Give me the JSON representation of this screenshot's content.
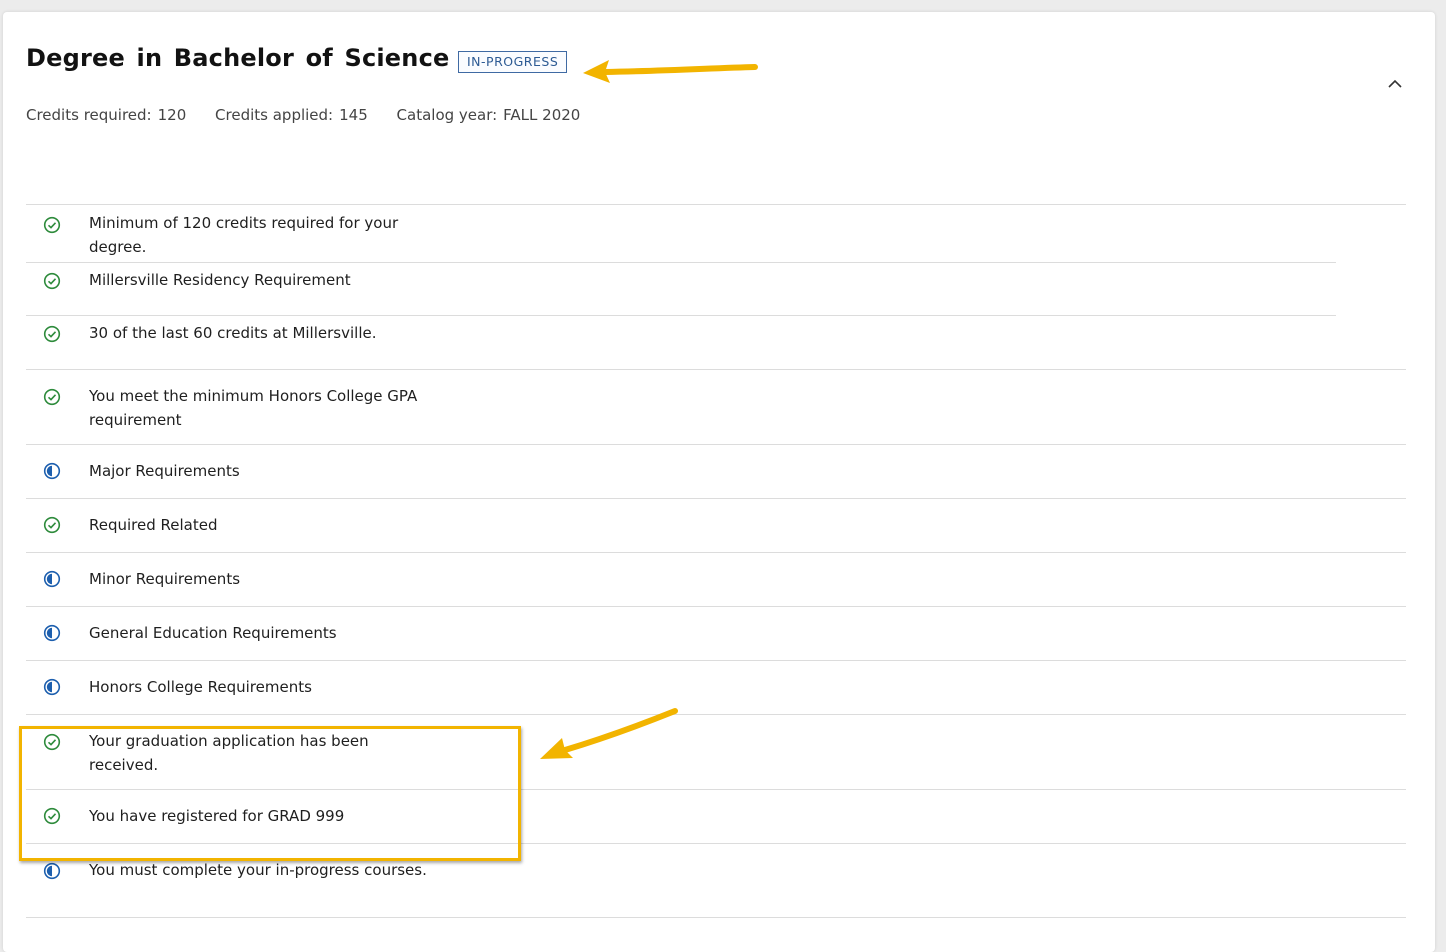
{
  "degree": {
    "title": "Degree in Bachelor of Science",
    "status": "IN-PROGRESS",
    "credits_required_label": "Credits required:",
    "credits_required": "120",
    "credits_applied_label": "Credits applied:",
    "credits_applied": "145",
    "catalog_year_label": "Catalog year:",
    "catalog_year": "FALL 2020"
  },
  "colors": {
    "complete": "#2e8b3c",
    "in_progress": "#1d5fae",
    "annotation": "#f2b400"
  },
  "requirements": [
    {
      "label": "Minimum of 120 credits required for your degree.",
      "status": "complete",
      "icon": "check-circle-icon"
    },
    {
      "label": "Millersville Residency Requirement",
      "status": "complete",
      "icon": "check-circle-icon"
    },
    {
      "label": "30 of the last 60 credits at Millersville.",
      "status": "complete",
      "icon": "check-circle-icon"
    },
    {
      "label": "You meet the minimum Honors College GPA requirement",
      "status": "complete",
      "icon": "check-circle-icon"
    },
    {
      "label": "Major Requirements",
      "status": "in-progress",
      "icon": "half-circle-icon"
    },
    {
      "label": "Required Related",
      "status": "complete",
      "icon": "check-circle-icon"
    },
    {
      "label": "Minor Requirements",
      "status": "in-progress",
      "icon": "half-circle-icon"
    },
    {
      "label": "General Education Requirements",
      "status": "in-progress",
      "icon": "half-circle-icon"
    },
    {
      "label": "Honors College Requirements",
      "status": "in-progress",
      "icon": "half-circle-icon"
    },
    {
      "label": "Your graduation application has been received.",
      "status": "complete",
      "icon": "check-circle-icon"
    },
    {
      "label": "You have registered for GRAD 999",
      "status": "complete",
      "icon": "check-circle-icon"
    },
    {
      "label": "You must complete your in-progress courses.",
      "status": "in-progress",
      "icon": "half-circle-icon"
    }
  ]
}
